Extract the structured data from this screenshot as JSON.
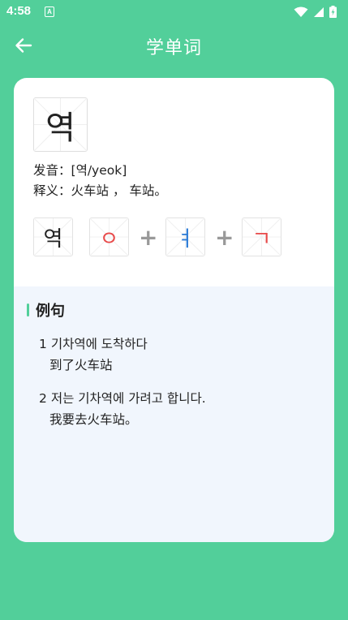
{
  "status_bar": {
    "time": "4:58",
    "notification_letter": "A"
  },
  "app_bar": {
    "title": "学单词"
  },
  "word": {
    "character": "역",
    "pronunciation_label": "发音：",
    "pronunciation": "[역/yeok]",
    "meaning_label": "释义：",
    "meaning": "火车站 ， 车站。"
  },
  "decomposition": {
    "syllable": "역",
    "jamo": [
      {
        "char": "ㅇ",
        "color": "#e84a4a"
      },
      {
        "char": "ㅕ",
        "color": "#2b7bd6"
      },
      {
        "char": "ㄱ",
        "color": "#e84a4a"
      }
    ],
    "plus": "+"
  },
  "examples": {
    "title": "例句",
    "items": [
      {
        "number": "1",
        "korean": "기차역에 도착하다",
        "chinese": "到了火车站"
      },
      {
        "number": "2",
        "korean": "저는 기차역에 가려고 합니다.",
        "chinese": "我要去火车站。"
      }
    ]
  },
  "colors": {
    "primary": "#52cf9a",
    "card": "#ffffff",
    "example_bg": "#f1f6fd"
  }
}
